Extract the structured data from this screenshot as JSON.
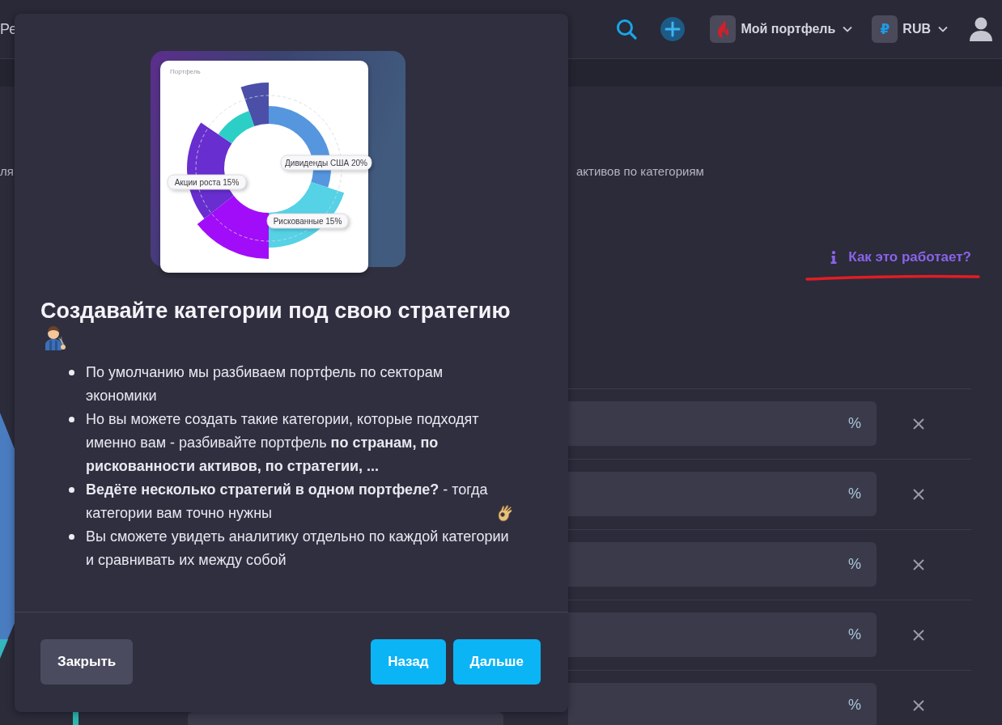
{
  "top_bar": {
    "title_fragment": "Ре",
    "portfolio": {
      "label": "Мой портфель"
    },
    "currency": {
      "symbol": "₽",
      "code": "RUB"
    }
  },
  "page": {
    "left_fragment": "ля",
    "subtitle_fragment": "активов по категориям",
    "help_link": {
      "label": "Как это работает?"
    },
    "category_rows": [
      {
        "unit": "%"
      },
      {
        "unit": "%"
      },
      {
        "unit": "%"
      },
      {
        "unit": "%"
      },
      {
        "unit": "%"
      }
    ]
  },
  "modal": {
    "illustration": {
      "card_title": "Портфель",
      "labels": [
        "Дивиденды США 20%",
        "Акции роста 15%",
        "Рискованные 15%"
      ]
    },
    "title": "Создавайте категории под свою стратегию",
    "title_emoji": true,
    "bullets": [
      {
        "text": "По умолчанию мы разбиваем портфель по секторам экономики",
        "trailing_emoji": false
      },
      {
        "text": "Но вы можете создать такие категории, которые подходят именно вам - разбивайте портфель **по странам, по рискованности активов, по стратегии, ...**",
        "trailing_emoji": false
      },
      {
        "text": "**Ведёте несколько стратегий в одном портфеле?** - тогда категории вам точно нужны",
        "trailing_emoji": true
      },
      {
        "text": "Вы сможете увидеть аналитику отдельно по каждой категории и сравнивать их между собой",
        "trailing_emoji": false
      }
    ],
    "buttons": [
      {
        "label": "Закрыть",
        "kind": "secondary"
      },
      {
        "label": "Назад",
        "kind": "primary"
      },
      {
        "label": "Дальше",
        "kind": "primary"
      }
    ]
  }
}
